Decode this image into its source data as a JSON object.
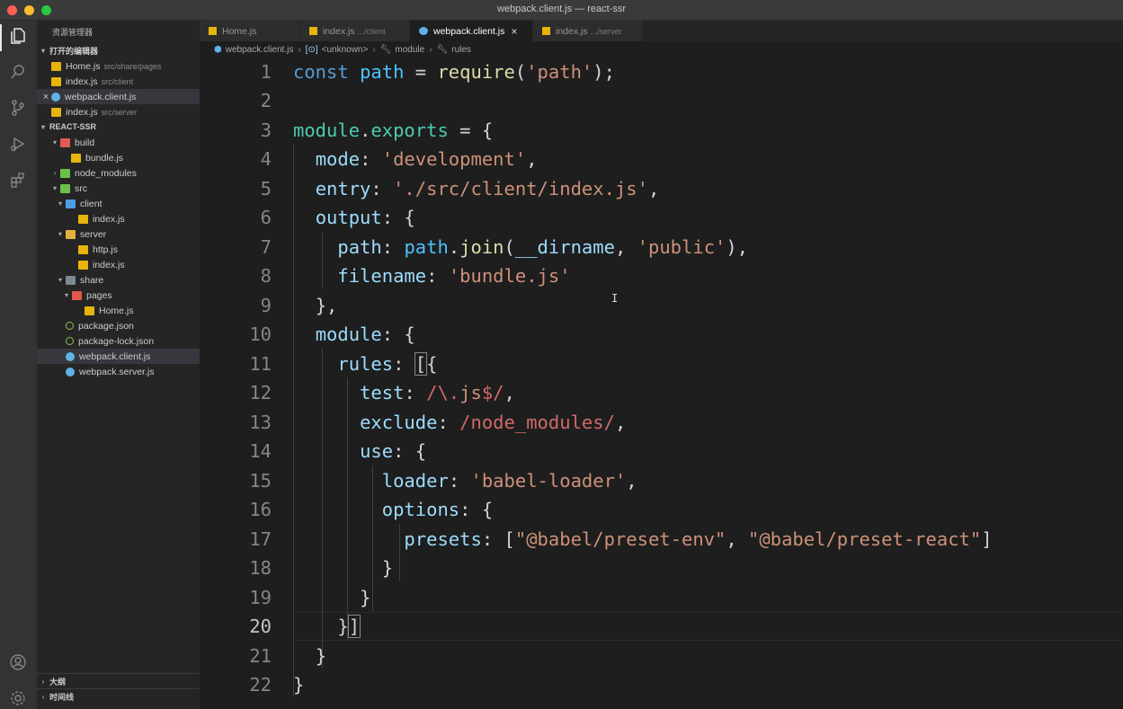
{
  "window": {
    "title": "webpack.client.js — react-ssr"
  },
  "activity_bar": {
    "items": [
      {
        "icon": "files-icon"
      },
      {
        "icon": "search-icon"
      },
      {
        "icon": "source-control-icon"
      },
      {
        "icon": "run-debug-icon"
      },
      {
        "icon": "extensions-icon"
      }
    ],
    "bottom": [
      {
        "icon": "account-icon"
      },
      {
        "icon": "settings-gear-icon"
      }
    ]
  },
  "sidebar": {
    "title": "资源管理器",
    "open_editors": {
      "header": "打开的编辑器",
      "items": [
        {
          "name": "Home.js",
          "hint": "src/share/pages"
        },
        {
          "name": "index.js",
          "hint": "src/client"
        },
        {
          "name": "webpack.client.js",
          "hint": ""
        },
        {
          "name": "index.js",
          "hint": "src/server"
        }
      ]
    },
    "project": {
      "header": "REACT-SSR",
      "tree": [
        {
          "name": "build"
        },
        {
          "name": "bundle.js"
        },
        {
          "name": "node_modules"
        },
        {
          "name": "src"
        },
        {
          "name": "client"
        },
        {
          "name": "index.js"
        },
        {
          "name": "server"
        },
        {
          "name": "http.js"
        },
        {
          "name": "index.js"
        },
        {
          "name": "share"
        },
        {
          "name": "pages"
        },
        {
          "name": "Home.js"
        },
        {
          "name": "package.json"
        },
        {
          "name": "package-lock.json"
        },
        {
          "name": "webpack.client.js"
        },
        {
          "name": "webpack.server.js"
        }
      ]
    },
    "outline_header": "大纲",
    "timeline_header": "时间线"
  },
  "tabs": [
    {
      "label": "Home.js",
      "hint": ""
    },
    {
      "label": "index.js",
      "hint": ".../client"
    },
    {
      "label": "webpack.client.js",
      "hint": ""
    },
    {
      "label": "index.js",
      "hint": ".../server"
    }
  ],
  "breadcrumb": {
    "file": "webpack.client.js",
    "items": [
      "<unknown>",
      "module",
      "rules"
    ]
  },
  "editor": {
    "line_numbers": [
      "1",
      "2",
      "3",
      "4",
      "5",
      "6",
      "7",
      "8",
      "9",
      "10",
      "11",
      "12",
      "13",
      "14",
      "15",
      "16",
      "17",
      "18",
      "19",
      "20",
      "21",
      "22"
    ]
  }
}
